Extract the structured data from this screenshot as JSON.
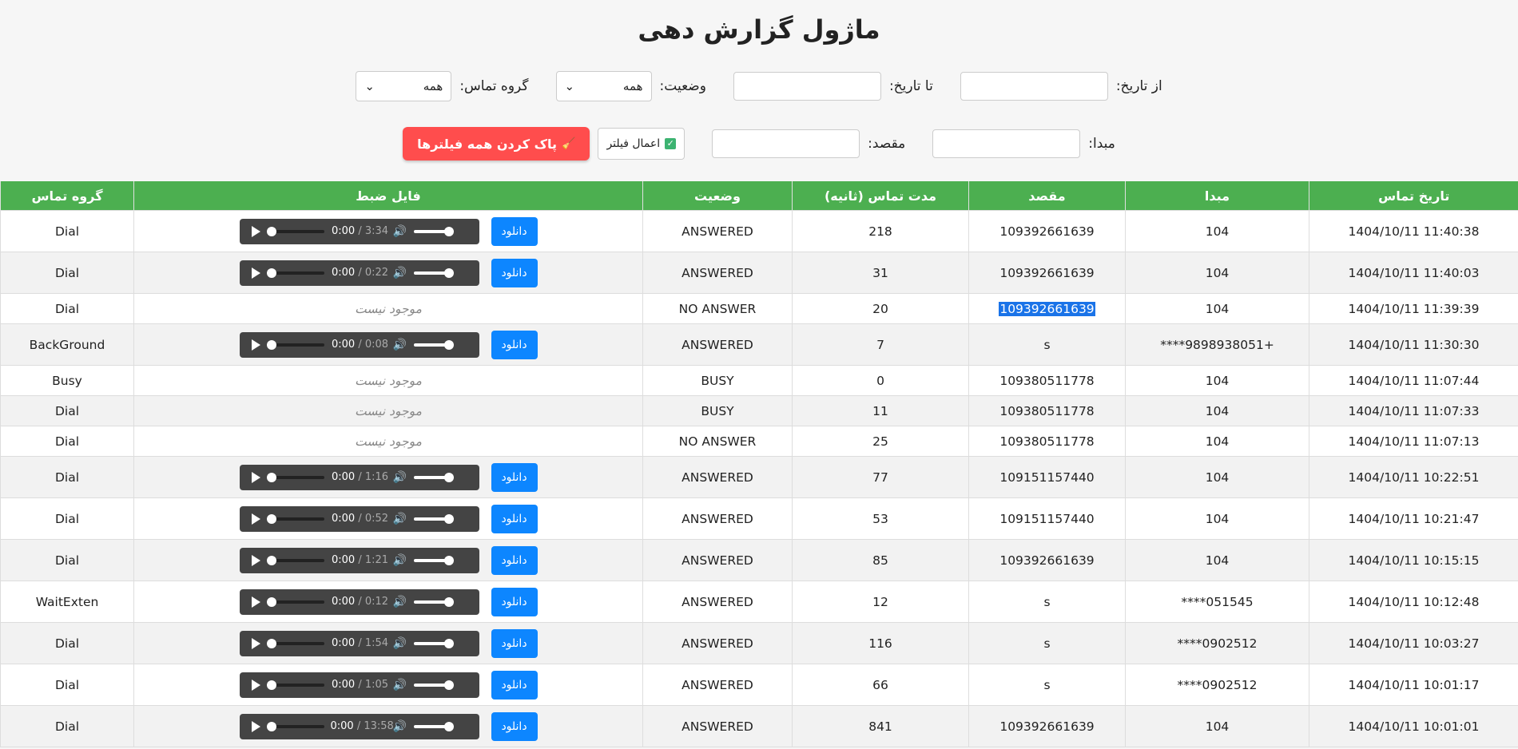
{
  "title": "ماژول گزارش دهی",
  "filters": {
    "from_date_label": "از تاریخ:",
    "to_date_label": "تا تاریخ:",
    "status_label": "وضعیت:",
    "status_value": "همه",
    "group_label": "گروه تماس:",
    "group_value": "همه",
    "source_label": "مبدا:",
    "destination_label": "مقصد:",
    "apply_label": "اعمال فیلتر",
    "clear_label": "پاک کردن همه فیلترها"
  },
  "table": {
    "headers": {
      "date": "تاریخ تماس",
      "source": "مبدا",
      "destination": "مقصد",
      "duration": "مدت تماس (ثانیه)",
      "status": "وضعیت",
      "recording": "فایل ضبط",
      "group": "گروه تماس"
    },
    "download_label": "دانلود",
    "not_available_label": "موجود نیست",
    "rows": [
      {
        "date": "1404/10/11 11:40:38",
        "source": "104",
        "destination": "109392661639",
        "duration": "218",
        "status": "ANSWERED",
        "recording": true,
        "player_current": "0:00",
        "player_total": "/ 3:34",
        "group": "Dial"
      },
      {
        "date": "1404/10/11 11:40:03",
        "source": "104",
        "destination": "109392661639",
        "duration": "31",
        "status": "ANSWERED",
        "recording": true,
        "player_current": "0:00",
        "player_total": "/ 0:22",
        "group": "Dial"
      },
      {
        "date": "1404/10/11 11:39:39",
        "source": "104",
        "destination": "109392661639",
        "duration": "20",
        "status": "NO ANSWER",
        "recording": false,
        "group": "Dial",
        "highlight": true
      },
      {
        "date": "1404/10/11 11:30:30",
        "source": "+9898938051****",
        "destination": "s",
        "duration": "7",
        "status": "ANSWERED",
        "recording": true,
        "player_current": "0:00",
        "player_total": "/ 0:08",
        "group": "BackGround"
      },
      {
        "date": "1404/10/11 11:07:44",
        "source": "104",
        "destination": "109380511778",
        "duration": "0",
        "status": "BUSY",
        "recording": false,
        "group": "Busy"
      },
      {
        "date": "1404/10/11 11:07:33",
        "source": "104",
        "destination": "109380511778",
        "duration": "11",
        "status": "BUSY",
        "recording": false,
        "group": "Dial"
      },
      {
        "date": "1404/10/11 11:07:13",
        "source": "104",
        "destination": "109380511778",
        "duration": "25",
        "status": "NO ANSWER",
        "recording": false,
        "group": "Dial"
      },
      {
        "date": "1404/10/11 10:22:51",
        "source": "104",
        "destination": "109151157440",
        "duration": "77",
        "status": "ANSWERED",
        "recording": true,
        "player_current": "0:00",
        "player_total": "/ 1:16",
        "group": "Dial"
      },
      {
        "date": "1404/10/11 10:21:47",
        "source": "104",
        "destination": "109151157440",
        "duration": "53",
        "status": "ANSWERED",
        "recording": true,
        "player_current": "0:00",
        "player_total": "/ 0:52",
        "group": "Dial"
      },
      {
        "date": "1404/10/11 10:15:15",
        "source": "104",
        "destination": "109392661639",
        "duration": "85",
        "status": "ANSWERED",
        "recording": true,
        "player_current": "0:00",
        "player_total": "/ 1:21",
        "group": "Dial"
      },
      {
        "date": "1404/10/11 10:12:48",
        "source": "051545****",
        "destination": "s",
        "duration": "12",
        "status": "ANSWERED",
        "recording": true,
        "player_current": "0:00",
        "player_total": "/ 0:12",
        "group": "WaitExten"
      },
      {
        "date": "1404/10/11 10:03:27",
        "source": "0902512****",
        "destination": "s",
        "duration": "116",
        "status": "ANSWERED",
        "recording": true,
        "player_current": "0:00",
        "player_total": "/ 1:54",
        "group": "Dial"
      },
      {
        "date": "1404/10/11 10:01:17",
        "source": "0902512****",
        "destination": "s",
        "duration": "66",
        "status": "ANSWERED",
        "recording": true,
        "player_current": "0:00",
        "player_total": "/ 1:05",
        "group": "Dial"
      },
      {
        "date": "1404/10/11 10:01:01",
        "source": "104",
        "destination": "109392661639",
        "duration": "841",
        "status": "ANSWERED",
        "recording": true,
        "player_current": "0:00",
        "player_total": "/ 13:58",
        "group": "Dial"
      }
    ]
  }
}
